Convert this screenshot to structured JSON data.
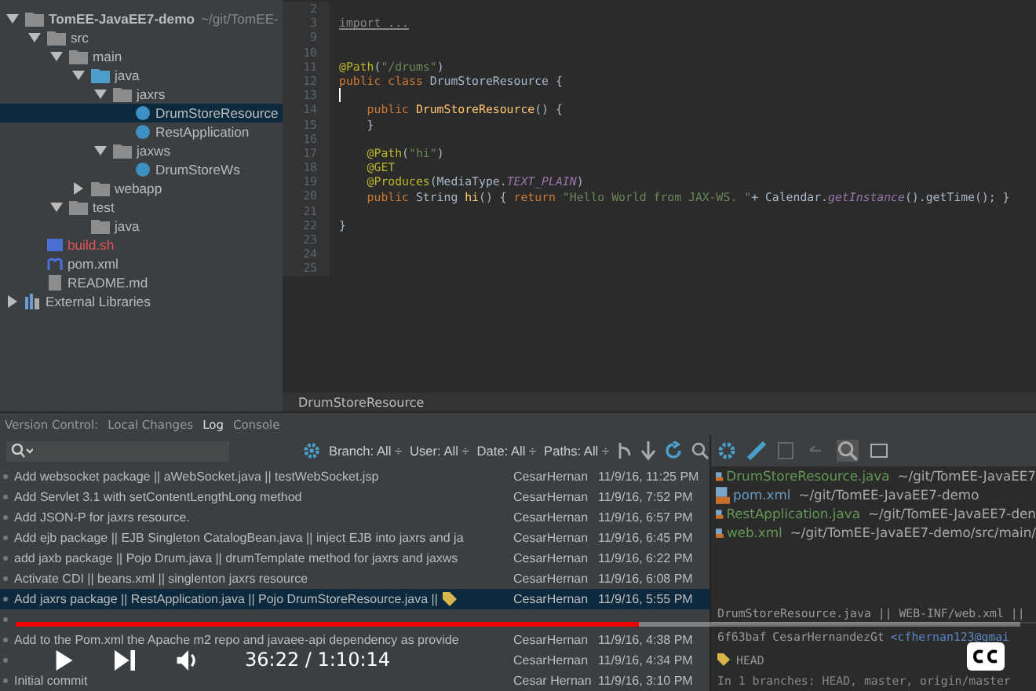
{
  "project_tree": [
    {
      "label": "TomEE-JavaEE7-demo",
      "path": "~/git/TomEE-",
      "kind": "project",
      "expanded": true,
      "selected": false,
      "children": [
        {
          "label": "src",
          "kind": "folder",
          "expanded": true,
          "selected": false,
          "children": [
            {
              "label": "main",
              "kind": "folder",
              "expanded": true,
              "selected": false,
              "children": [
                {
                  "label": "java",
                  "kind": "source",
                  "expanded": true,
                  "selected": false,
                  "children": [
                    {
                      "label": "jaxrs",
                      "kind": "package",
                      "expanded": true,
                      "selected": false,
                      "children": [
                        {
                          "label": "DrumStoreResource",
                          "kind": "class",
                          "selected": true
                        },
                        {
                          "label": "RestApplication",
                          "kind": "class",
                          "selected": false
                        }
                      ]
                    },
                    {
                      "label": "jaxws",
                      "kind": "package",
                      "expanded": true,
                      "selected": false,
                      "children": [
                        {
                          "label": "DrumStoreWs",
                          "kind": "class",
                          "selected": false
                        }
                      ]
                    }
                  ]
                },
                {
                  "label": "webapp",
                  "kind": "folder",
                  "expanded": false,
                  "selected": false
                }
              ]
            },
            {
              "label": "test",
              "kind": "folder",
              "expanded": true,
              "selected": false,
              "children": [
                {
                  "label": "java",
                  "kind": "folder",
                  "selected": false
                }
              ]
            }
          ]
        },
        {
          "label": "build.sh",
          "kind": "shell",
          "selected": false
        },
        {
          "label": "pom.xml",
          "kind": "maven",
          "selected": false
        },
        {
          "label": "README.md",
          "kind": "markdown",
          "selected": false
        }
      ]
    },
    {
      "label": "External Libraries",
      "kind": "library",
      "expanded": false,
      "selected": false
    }
  ],
  "editor": {
    "lines": [
      {
        "number": "2"
      },
      {
        "number": "3",
        "tokens": [
          {
            "text": "import ...",
            "kind": "folded"
          }
        ]
      },
      {
        "number": "9"
      },
      {
        "number": "10"
      },
      {
        "number": "11",
        "tokens": [
          {
            "text": "@Path",
            "kind": "annotation"
          },
          {
            "text": "(",
            "kind": "plain"
          },
          {
            "text": "\"/drums\"",
            "kind": "string"
          },
          {
            "text": ")",
            "kind": "plain"
          }
        ]
      },
      {
        "number": "12",
        "tokens": [
          {
            "text": "public class ",
            "kind": "keyword"
          },
          {
            "text": "DrumStoreResource {",
            "kind": "plain"
          }
        ]
      },
      {
        "number": "13",
        "cursor": true
      },
      {
        "number": "14",
        "tokens": [
          {
            "text": "    public ",
            "kind": "keyword"
          },
          {
            "text": "DrumStoreResource",
            "kind": "method"
          },
          {
            "text": "() {",
            "kind": "plain"
          }
        ]
      },
      {
        "number": "15",
        "tokens": [
          {
            "text": "    }",
            "kind": "plain"
          }
        ]
      },
      {
        "number": "16"
      },
      {
        "number": "17",
        "tokens": [
          {
            "text": "    @Path",
            "kind": "annotation"
          },
          {
            "text": "(",
            "kind": "plain"
          },
          {
            "text": "\"hi\"",
            "kind": "string"
          },
          {
            "text": ")",
            "kind": "plain"
          }
        ]
      },
      {
        "number": "18",
        "tokens": [
          {
            "text": "    @GET",
            "kind": "annotation"
          }
        ]
      },
      {
        "number": "19",
        "tokens": [
          {
            "text": "    @Produces",
            "kind": "annotation"
          },
          {
            "text": "(MediaType.",
            "kind": "plain"
          },
          {
            "text": "TEXT_PLAIN",
            "kind": "constant"
          },
          {
            "text": ")",
            "kind": "plain"
          }
        ]
      },
      {
        "number": "20",
        "tokens": [
          {
            "text": "    public ",
            "kind": "keyword"
          },
          {
            "text": "String ",
            "kind": "plain"
          },
          {
            "text": "hi",
            "kind": "method"
          },
          {
            "text": "() { ",
            "kind": "plain"
          },
          {
            "text": "return ",
            "kind": "keyword"
          },
          {
            "text": "\"Hello World from JAX-WS. \"",
            "kind": "string"
          },
          {
            "text": "+ Calendar.",
            "kind": "plain"
          },
          {
            "text": "getInstance",
            "kind": "constant"
          },
          {
            "text": "().getTime(); }",
            "kind": "plain"
          }
        ]
      },
      {
        "number": "21"
      },
      {
        "number": "22",
        "tokens": [
          {
            "text": "}",
            "kind": "plain"
          }
        ]
      },
      {
        "number": "23"
      },
      {
        "number": "24"
      },
      {
        "number": "25"
      }
    ],
    "breadcrumb": "DrumStoreResource"
  },
  "tool_tabs": [
    {
      "label": "Version Control:",
      "selected": false
    },
    {
      "label": "Local Changes",
      "selected": false
    },
    {
      "label": "Log",
      "selected": true
    },
    {
      "label": "Console",
      "selected": false
    }
  ],
  "filters": [
    "Branch: All ÷",
    "User: All ÷",
    "Date: All ÷",
    "Paths: All ÷"
  ],
  "commits": [
    {
      "message": "Add websocket package || aWebSocket.java || testWebSocket.jsp",
      "author": "CesarHernan",
      "date": "11/9/16, 11:25 PM",
      "selected": false,
      "tagged": false
    },
    {
      "message": "Add Servlet 3.1 with setContentLengthLong method",
      "author": "CesarHernan",
      "date": "11/9/16, 7:52 PM",
      "selected": false,
      "tagged": false
    },
    {
      "message": "Add JSON-P for jaxrs resource.",
      "author": "CesarHernan",
      "date": "11/9/16, 6:57 PM",
      "selected": false,
      "tagged": false
    },
    {
      "message": "Add ejb package || EJB Singleton CatalogBean.java || inject EJB into jaxrs and ja",
      "author": "CesarHernan",
      "date": "11/9/16, 6:45 PM",
      "selected": false,
      "tagged": false
    },
    {
      "message": "add jaxb package || Pojo Drum.java || drumTemplate method for jaxrs and jaxws",
      "author": "CesarHernan",
      "date": "11/9/16, 6:22 PM",
      "selected": false,
      "tagged": false
    },
    {
      "message": "Activate CDI || beans.xml || singlenton jaxrs resource",
      "author": "CesarHernan",
      "date": "11/9/16, 6:08 PM",
      "selected": false,
      "tagged": false
    },
    {
      "message": "Add jaxrs package || RestApplication.java || Pojo DrumStoreResource.java ||",
      "author": "CesarHernan",
      "date": "11/9/16, 5:55 PM",
      "selected": true,
      "tagged": true
    },
    {
      "selected": false,
      "tagged": false
    },
    {
      "message": "Add to the  Pom.xml the Apache m2  repo and javaee-api dependency as provide",
      "author": "CesarHernan",
      "date": "11/9/16, 4:38 PM",
      "selected": false,
      "tagged": false
    },
    {
      "author": "CesarHernan",
      "date": "11/9/16, 4:34 PM",
      "selected": false,
      "tagged": false
    },
    {
      "message": "Initial commit",
      "author": "Cesar Hernan",
      "date": "11/9/16, 3:10 PM",
      "selected": false,
      "tagged": false
    }
  ],
  "changed_files": [
    {
      "name": "DrumStoreResource.java",
      "path": "~/git/TomEE-JavaEE7",
      "color": "#629755"
    },
    {
      "name": "pom.xml",
      "path": "~/git/TomEE-JavaEE7-demo",
      "color": "#6897bb"
    },
    {
      "name": "RestApplication.java",
      "path": "~/git/TomEE-JavaEE7-den",
      "color": "#629755"
    },
    {
      "name": "web.xml",
      "path": "~/git/TomEE-JavaEE7-demo/src/main/",
      "color": "#629755"
    }
  ],
  "commit_details": {
    "files": "DrumStoreResource.java || WEB-INF/web.xml ||",
    "hash": "6f63baf",
    "author": "CesarHernandezGt",
    "email": "<cfhernan123@gmai",
    "ref": "HEAD",
    "branches": "In 1 branches: HEAD, master, origin/master"
  },
  "player": {
    "level": 0.62,
    "time": "36:22 / 1:10:14"
  }
}
